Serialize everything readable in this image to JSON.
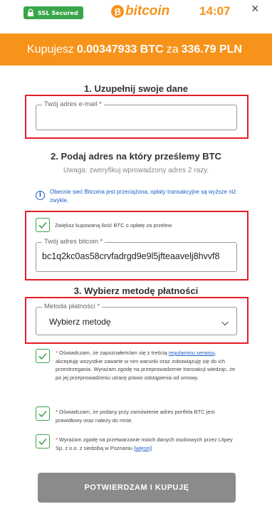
{
  "header": {
    "ssl_label": "SSL Secured",
    "brand_symbol": "B",
    "brand_word": "bitcoin",
    "timer": "14:07",
    "close": "×"
  },
  "banner": {
    "prefix": "Kupujesz",
    "btc_amount": "0.00347933 BTC",
    "middle": "za",
    "pln_amount": "336.79 PLN"
  },
  "step1": {
    "title": "1. Uzupełnij swoje dane",
    "email_label": "Twój adres e-mail *",
    "email_value": ""
  },
  "step2": {
    "title": "2. Podaj adres na który prześlemy BTC",
    "subtitle": "Uwaga: zweryfikuj wprowadzony adres 2 razy.",
    "info_icon": "i",
    "info_text": "Obecnie sieć Bitcoina jest przeciążona, opłaty transakcyjne są wyższe niż zwykle.",
    "fee_checkbox_label": "Zwiększ kupowaną ilość BTC o opłatę za przelew",
    "fee_checkbox_checked": true,
    "address_label": "Twój adres bitcoin *",
    "address_value": "bc1q2kc0as58crvfadrgd9e9l5jfteaavelj8hvvf8"
  },
  "step3": {
    "title": "3. Wybierz metodę płatności",
    "method_label": "Metoda płatności *",
    "method_value": "Wybierz metodę"
  },
  "consents": [
    {
      "checked": true,
      "star": "*",
      "text_before": " Oświadczam, że zapoznałem/am się z treścią ",
      "link": "regulaminu serwisu",
      "text_after": ", akceptuję wszystkie zawarte w nim warunki oraz zobowiązuję się do ich przestrzegania. Wyrażam zgodę na przeprowadzenie transakcji wiedząc, że po jej przeprowadzeniu utracę prawo odstąpienia od umowy."
    },
    {
      "checked": true,
      "star": "*",
      "text_before": " Oświadczam, że podany przy zamówienie adres portfela BTC jest prawidłowy oraz należy do mnie.",
      "link": "",
      "text_after": ""
    },
    {
      "checked": true,
      "star": "*",
      "text_before": " Wyrażam zgodę na przetwarzanie moich danych osobowych przez Litpey Sp. z o.o. z siedzibą w Poznaniu ",
      "link": "[więcej]",
      "text_after": ""
    }
  ],
  "submit_label": "POTWIERDZAM I KUPUJĘ",
  "colors": {
    "brand_orange": "#f7931a",
    "highlight_red": "#e41f26",
    "check_green": "#3aa64a",
    "link_blue": "#1a5ec9",
    "button_gray": "#8b8b8b"
  }
}
